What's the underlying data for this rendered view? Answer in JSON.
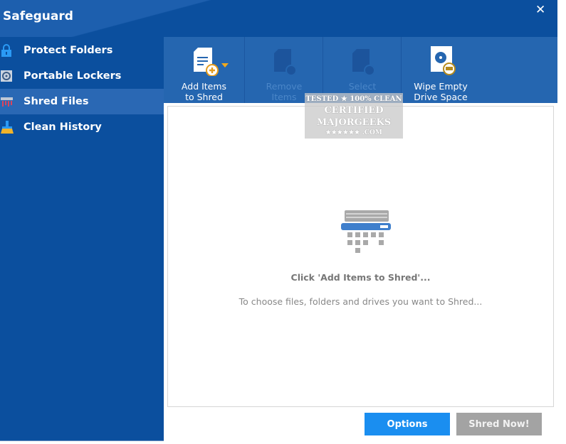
{
  "app": {
    "title": "Safeguard",
    "close_label": "✕"
  },
  "sidebar": {
    "items": [
      {
        "label": "Protect Folders",
        "icon": "lock-icon"
      },
      {
        "label": "Portable Lockers",
        "icon": "disc-icon"
      },
      {
        "label": "Shred Files",
        "icon": "shredder-icon",
        "selected": true
      },
      {
        "label": "Clean History",
        "icon": "broom-icon"
      }
    ]
  },
  "toolbar": {
    "add": {
      "line1": "Add Items",
      "line2": "to Shred"
    },
    "remove": {
      "line1": "Remove",
      "line2": "Items"
    },
    "select": {
      "line1": "Select",
      "line2": ""
    },
    "wipe": {
      "line1": "Wipe Empty",
      "line2": "Drive Space"
    }
  },
  "main": {
    "empty_title": "Click 'Add Items to Shred'...",
    "empty_subtitle": "To choose files, folders and drives you want to Shred..."
  },
  "footer": {
    "options": "Options",
    "shred": "Shred Now!"
  },
  "watermark": {
    "line1": "TESTED ★ 100% CLEAN",
    "line2": "CERTIFIED",
    "line3": "MAJORGEEKS",
    "line4": "★★★★★★ .COM"
  },
  "colors": {
    "primary": "#0b4f9e",
    "toolbar": "#2566b0",
    "options": "#1a8ef0",
    "shred_disabled": "#a3a3a3"
  }
}
